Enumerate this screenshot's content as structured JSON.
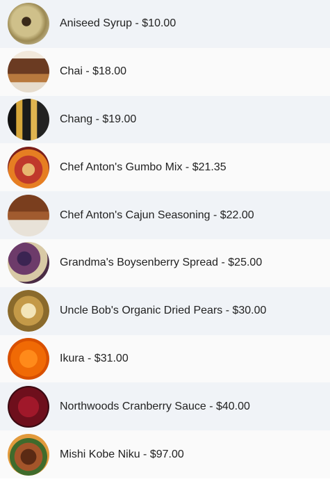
{
  "products": [
    {
      "label": "Aniseed Syrup - $10.00",
      "image": "aniseed-syrup-photo"
    },
    {
      "label": "Chai - $18.00",
      "image": "chai-photo"
    },
    {
      "label": "Chang - $19.00",
      "image": "chang-photo"
    },
    {
      "label": "Chef Anton's Gumbo Mix - $21.35",
      "image": "gumbo-mix-photo"
    },
    {
      "label": "Chef Anton's Cajun Seasoning - $22.00",
      "image": "cajun-seasoning-photo"
    },
    {
      "label": "Grandma's Boysenberry Spread - $25.00",
      "image": "boysenberry-spread-photo"
    },
    {
      "label": "Uncle Bob's Organic Dried Pears - $30.00",
      "image": "dried-pears-photo"
    },
    {
      "label": "Ikura - $31.00",
      "image": "ikura-photo"
    },
    {
      "label": "Northwoods Cranberry Sauce - $40.00",
      "image": "cranberry-sauce-photo"
    },
    {
      "label": "Mishi Kobe Niku - $97.00",
      "image": "kobe-niku-photo"
    }
  ],
  "colors": {
    "row_odd": "#f0f3f7",
    "row_even": "#fafafa",
    "text": "#222222"
  }
}
